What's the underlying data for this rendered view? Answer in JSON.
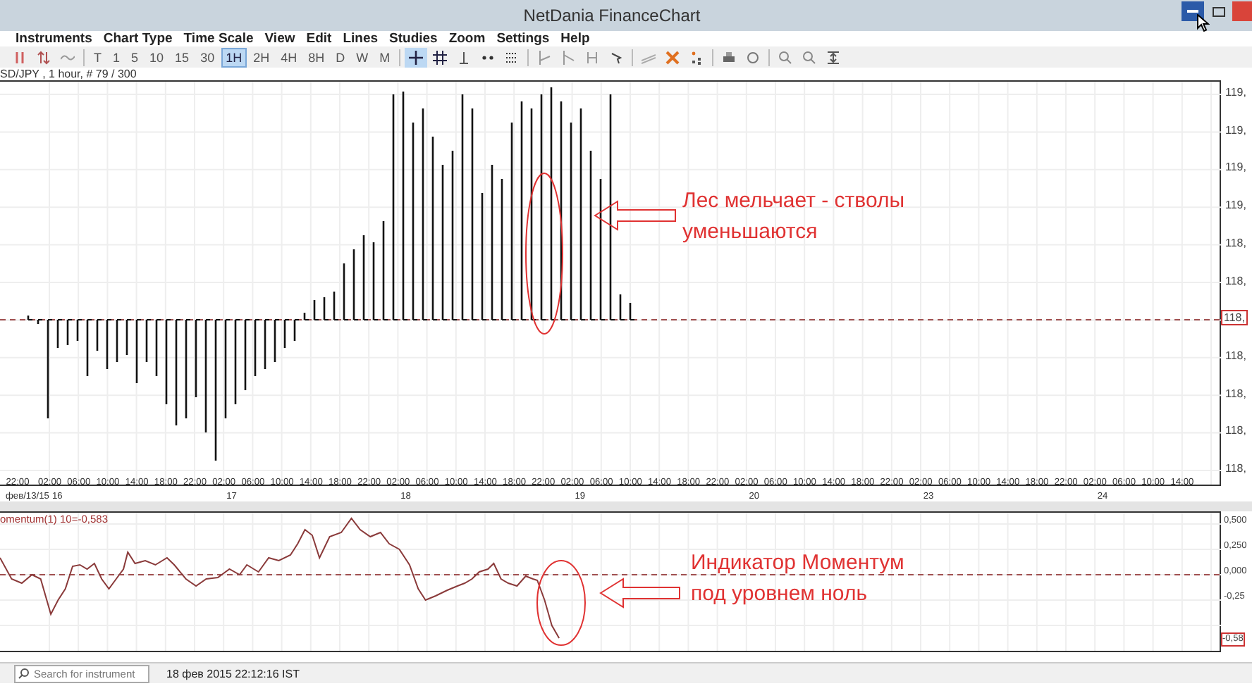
{
  "window": {
    "title": "NetDania FinanceChart"
  },
  "menu": [
    "Instruments",
    "Chart Type",
    "Time Scale",
    "View",
    "Edit",
    "Lines",
    "Studies",
    "Zoom",
    "Settings",
    "Help"
  ],
  "toolbar": {
    "timescales": [
      {
        "label": "T",
        "selected": false
      },
      {
        "label": "1",
        "selected": false
      },
      {
        "label": "5",
        "selected": false
      },
      {
        "label": "10",
        "selected": false
      },
      {
        "label": "15",
        "selected": false
      },
      {
        "label": "30",
        "selected": false
      },
      {
        "label": "1H",
        "selected": true
      },
      {
        "label": "2H",
        "selected": false
      },
      {
        "label": "4H",
        "selected": false
      },
      {
        "label": "8H",
        "selected": false
      },
      {
        "label": "D",
        "selected": false
      },
      {
        "label": "W",
        "selected": false
      },
      {
        "label": "M",
        "selected": false
      }
    ],
    "tools": [
      {
        "selected": true
      },
      {
        "selected": false
      },
      {
        "selected": false
      },
      {
        "selected": false
      },
      {
        "selected": false
      }
    ]
  },
  "price_chart": {
    "caption": "SD/JPY , 1 hour, # 79 / 300",
    "y_labels": [
      "119,",
      "119,",
      "119,",
      "119,",
      "118,",
      "118,",
      "118,",
      "118,",
      "118,",
      "118,"
    ],
    "current_label": "118,",
    "x_times": [
      "22:00",
      "02:00",
      "06:00",
      "10:00",
      "14:00",
      "18:00",
      "22:00",
      "02:00",
      "06:00",
      "10:00",
      "14:00",
      "18:00",
      "22:00",
      "02:00",
      "06:00",
      "10:00",
      "14:00",
      "18:00",
      "22:00",
      "02:00",
      "06:00",
      "10:00",
      "14:00",
      "18:00",
      "22:00",
      "02:00",
      "06:00",
      "10:00",
      "14:00",
      "18:00",
      "22:00",
      "02:00",
      "06:00",
      "10:00",
      "14:00",
      "18:00",
      "22:00",
      "02:00",
      "06:00",
      "10:00",
      "14:00"
    ],
    "x_dates": [
      "фев/13/15",
      "16",
      "17",
      "18",
      "19",
      "20",
      "23",
      "24"
    ],
    "note": [
      "Лес мельчает - стволы",
      "уменьшаются"
    ]
  },
  "momentum": {
    "caption": "omentum(1) 10=-0,583",
    "y_labels": [
      "0,500",
      "0,250",
      "0,000",
      "-0,25"
    ],
    "current_label": "-0,58",
    "note": [
      "Индикатор Моментум",
      "под уровнем ноль"
    ]
  },
  "status_bar": {
    "search": {
      "placeholder": "Search for instrument"
    },
    "timestamp": "18 фев 2015 22:12:16 IST"
  }
}
